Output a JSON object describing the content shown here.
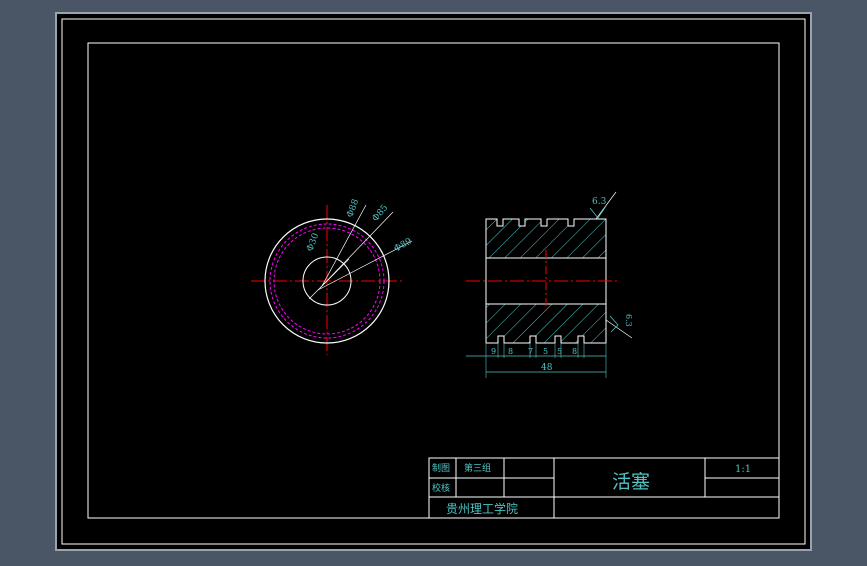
{
  "colors": {
    "background": "#4a5566",
    "paper": "#000000",
    "lines": "#ffffff",
    "centerline": "#ff0000",
    "hidden": "#ff00ff",
    "dimension": "#4fc3c3",
    "hatch": "#4fc3c3",
    "title_text": "#4fc3c3"
  },
  "title_block": {
    "drawn_label": "制图",
    "group": "第三组",
    "check_label": "校核",
    "part_name": "活塞",
    "scale": "1:1",
    "school": "贵州理工学院"
  },
  "front_view": {
    "dims": [
      "Φ30",
      "Φ88",
      "Φ85",
      "Φ89"
    ]
  },
  "side_view": {
    "roughness_top": "6.3",
    "roughness_side": "6.3",
    "groove_dims": [
      "9",
      "8",
      "7",
      "5",
      "5",
      "8"
    ],
    "width_dim": "48"
  }
}
